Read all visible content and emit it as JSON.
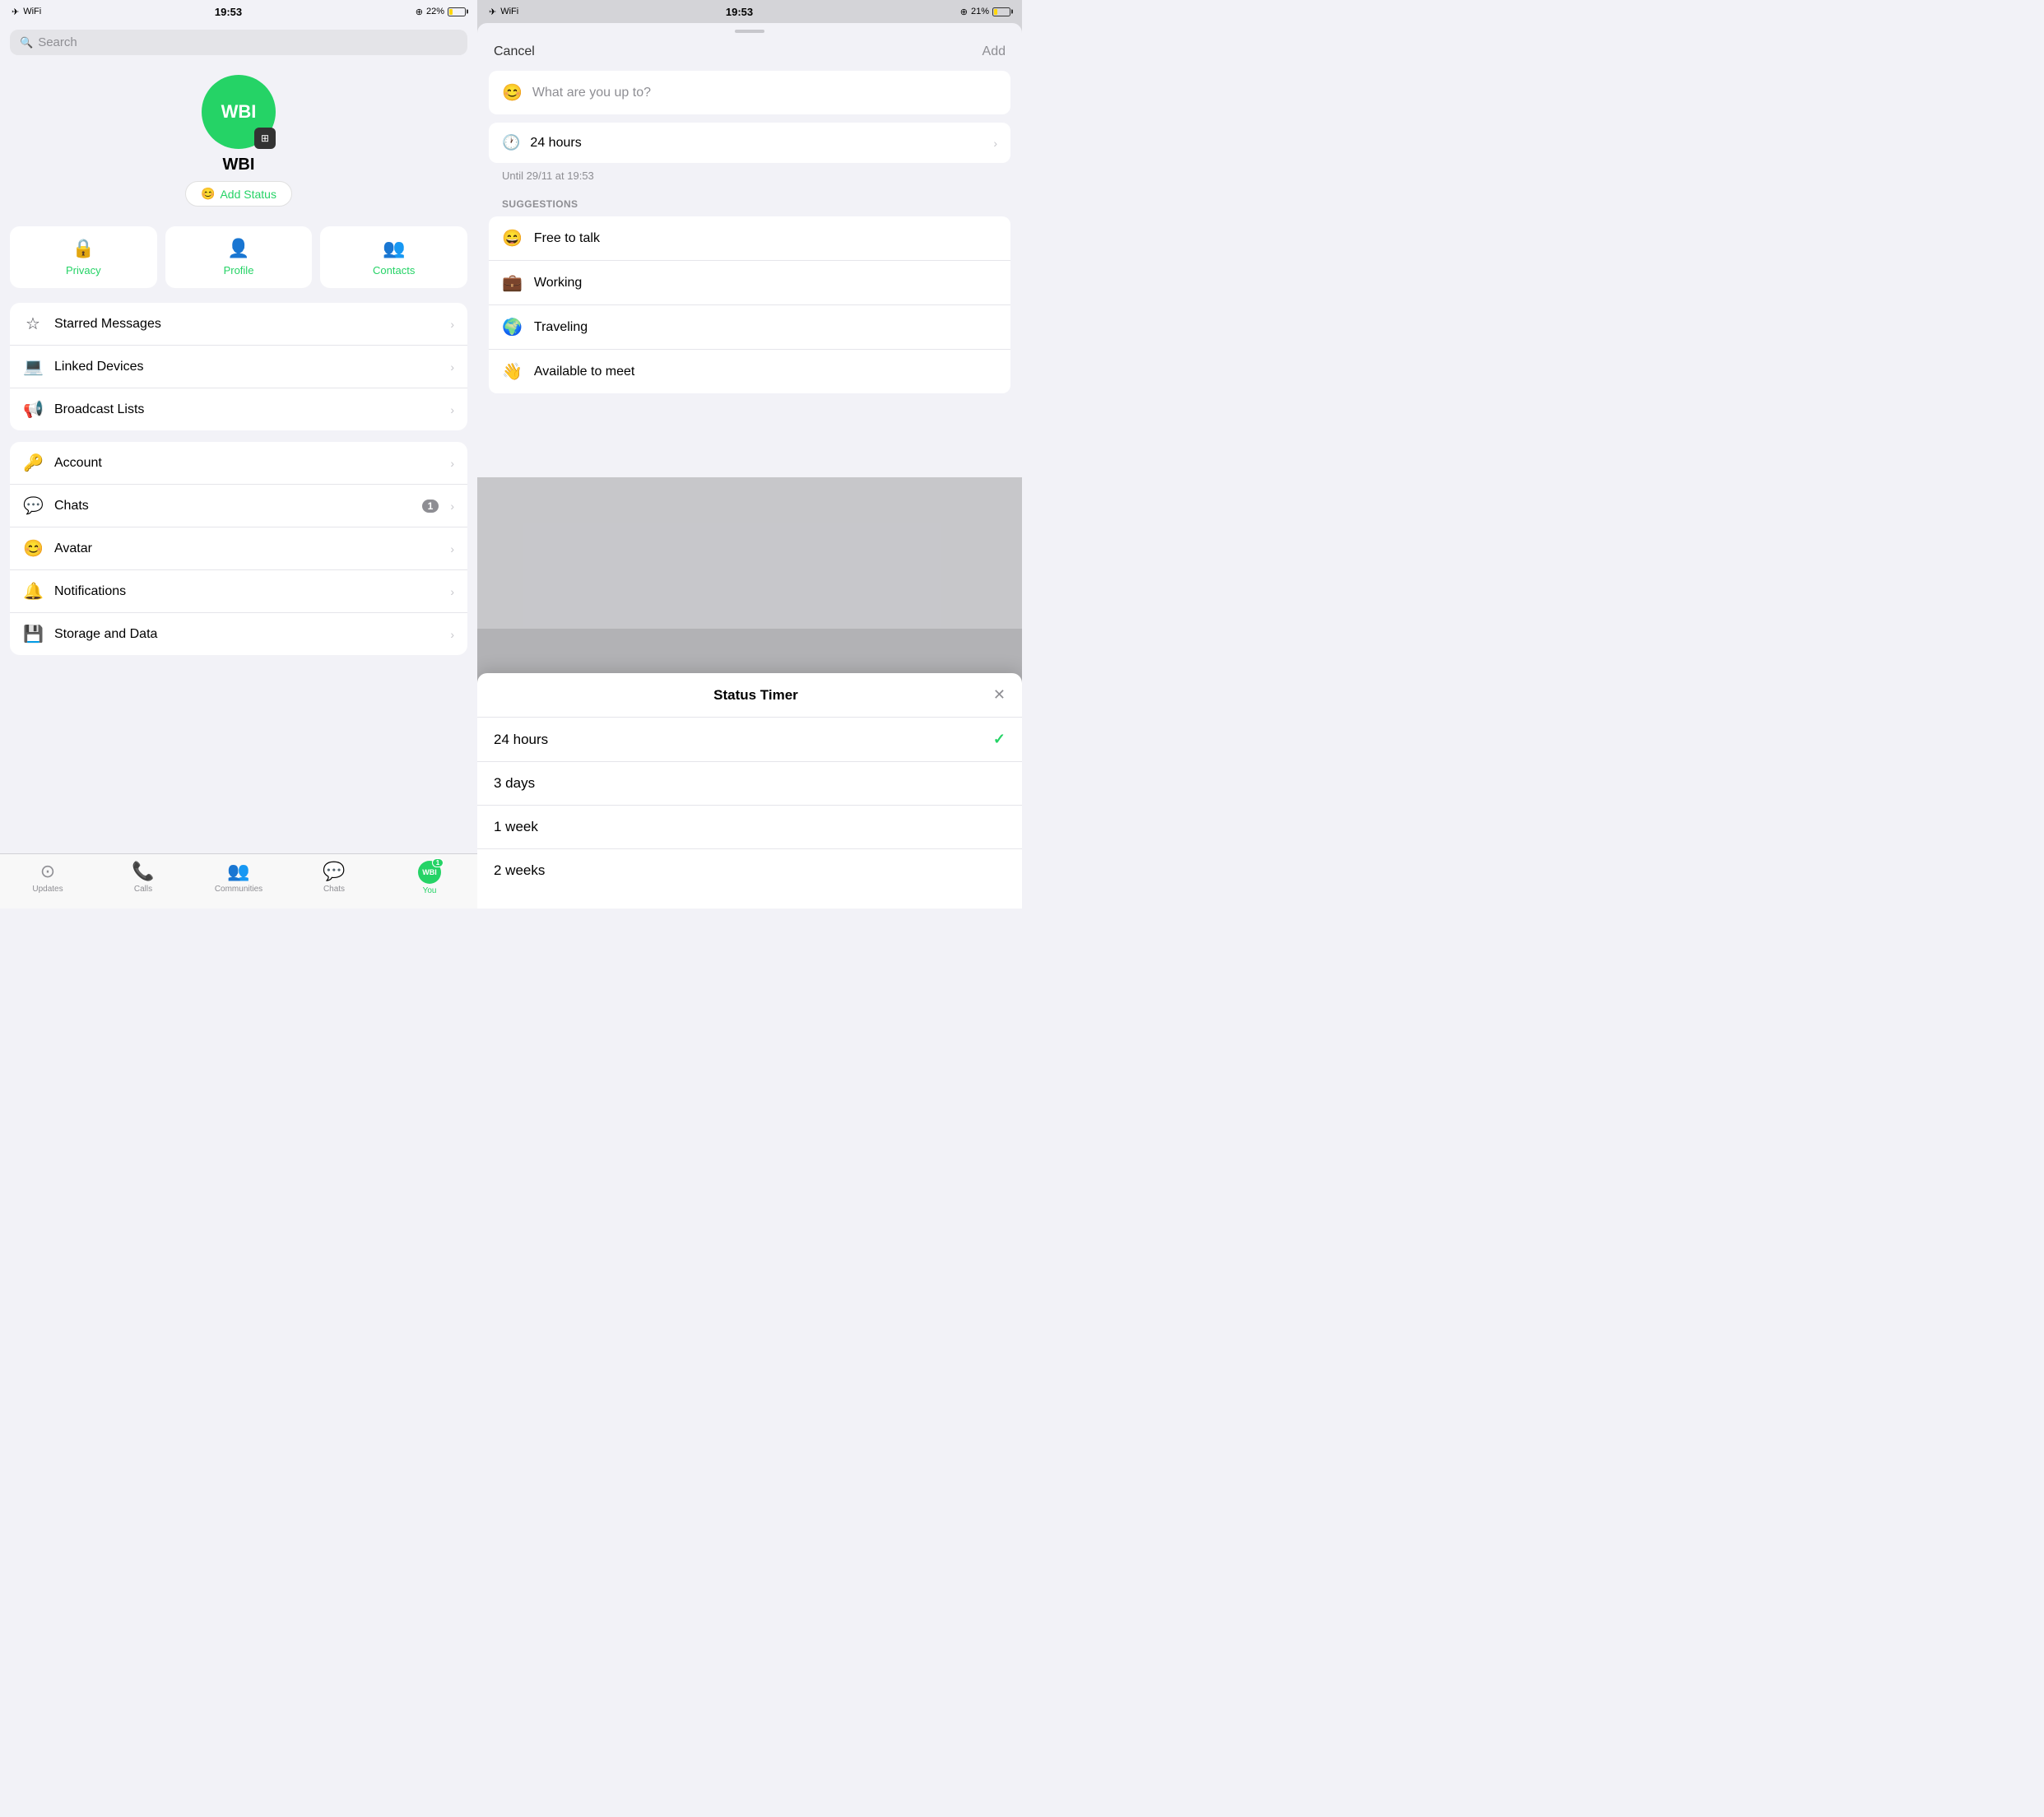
{
  "leftPanel": {
    "statusBar": {
      "time": "19:53",
      "battery": "22%"
    },
    "search": {
      "placeholder": "Search"
    },
    "profile": {
      "avatarText": "WBI",
      "name": "WBI",
      "addStatusLabel": "Add Status"
    },
    "quickActions": [
      {
        "icon": "🔒",
        "label": "Privacy"
      },
      {
        "icon": "👤",
        "label": "Profile"
      },
      {
        "icon": "👥",
        "label": "Contacts"
      }
    ],
    "menuGroup1": [
      {
        "icon": "☆",
        "label": "Starred Messages",
        "badge": ""
      },
      {
        "icon": "⬜",
        "label": "Linked Devices",
        "badge": ""
      },
      {
        "icon": "📢",
        "label": "Broadcast Lists",
        "badge": ""
      }
    ],
    "menuGroup2": [
      {
        "icon": "🔑",
        "label": "Account",
        "badge": ""
      },
      {
        "icon": "💬",
        "label": "Chats",
        "badge": "1"
      },
      {
        "icon": "😊",
        "label": "Avatar",
        "badge": ""
      },
      {
        "icon": "🔔",
        "label": "Notifications",
        "badge": ""
      },
      {
        "icon": "💾",
        "label": "Storage and Data",
        "badge": ""
      }
    ],
    "tabs": [
      {
        "icon": "⊙",
        "label": "Updates",
        "active": false
      },
      {
        "icon": "📞",
        "label": "Calls",
        "active": false
      },
      {
        "icon": "👥",
        "label": "Communities",
        "active": false
      },
      {
        "icon": "💬",
        "label": "Chats",
        "active": false
      },
      {
        "label": "You",
        "active": true,
        "avatarText": "WBI",
        "badge": "1"
      }
    ]
  },
  "rightPanel": {
    "statusBar": {
      "time": "19:53",
      "battery": "21%"
    },
    "addStatusSheet": {
      "cancelLabel": "Cancel",
      "addLabel": "Add",
      "inputPlaceholder": "What are you up to?",
      "timerLabel": "24 hours",
      "untilText": "Until 29/11 at 19:53",
      "suggestionsLabel": "SUGGESTIONS",
      "suggestions": [
        {
          "emoji": "😄",
          "text": "Free to talk"
        },
        {
          "emoji": "💼",
          "text": "Working"
        },
        {
          "emoji": "🌍",
          "text": "Traveling"
        },
        {
          "emoji": "👋",
          "text": "Available to meet"
        }
      ]
    },
    "statusTimerModal": {
      "title": "Status Timer",
      "options": [
        {
          "label": "24 hours",
          "selected": true
        },
        {
          "label": "3 days",
          "selected": false
        },
        {
          "label": "1 week",
          "selected": false
        },
        {
          "label": "2 weeks",
          "selected": false
        }
      ]
    }
  }
}
